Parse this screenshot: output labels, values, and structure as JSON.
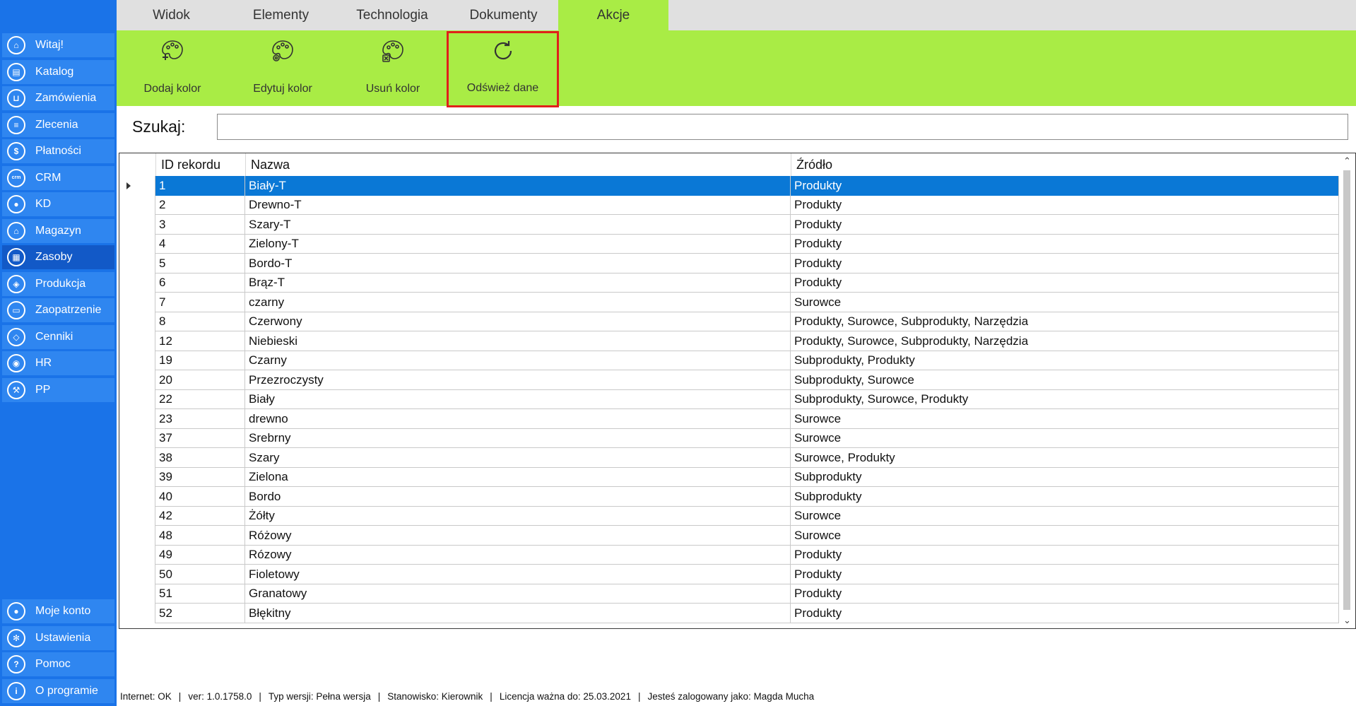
{
  "tabs": [
    {
      "label": "Widok",
      "active": false
    },
    {
      "label": "Elementy",
      "active": false
    },
    {
      "label": "Technologia",
      "active": false
    },
    {
      "label": "Dokumenty",
      "active": false
    },
    {
      "label": "Akcje",
      "active": true
    }
  ],
  "ribbon": {
    "buttons": [
      {
        "label": "Dodaj kolor",
        "icon": "palette-add-icon"
      },
      {
        "label": "Edytuj kolor",
        "icon": "palette-edit-icon"
      },
      {
        "label": "Usuń kolor",
        "icon": "palette-delete-icon"
      },
      {
        "label": "Odśwież dane",
        "icon": "refresh-icon",
        "highlighted": true
      }
    ]
  },
  "sidebar": {
    "items": [
      {
        "label": "Witaj!",
        "icon": "home-icon"
      },
      {
        "label": "Katalog",
        "icon": "book-icon"
      },
      {
        "label": "Zamówienia",
        "icon": "cart-icon"
      },
      {
        "label": "Zlecenia",
        "icon": "list-icon"
      },
      {
        "label": "Płatności",
        "icon": "dollar-icon"
      },
      {
        "label": "CRM",
        "icon": "crm-icon"
      },
      {
        "label": "KD",
        "icon": "person-icon"
      },
      {
        "label": "Magazyn",
        "icon": "warehouse-icon"
      },
      {
        "label": "Zasoby",
        "icon": "resources-icon",
        "active": true
      },
      {
        "label": "Produkcja",
        "icon": "production-icon"
      },
      {
        "label": "Zaopatrzenie",
        "icon": "truck-icon"
      },
      {
        "label": "Cenniki",
        "icon": "tag-icon"
      },
      {
        "label": "HR",
        "icon": "hr-icon"
      },
      {
        "label": "PP",
        "icon": "pp-icon"
      }
    ],
    "bottom_items": [
      {
        "label": "Moje konto",
        "icon": "account-icon"
      },
      {
        "label": "Ustawienia",
        "icon": "settings-icon"
      },
      {
        "label": "Pomoc",
        "icon": "help-icon"
      },
      {
        "label": "O programie",
        "icon": "info-icon"
      }
    ]
  },
  "search": {
    "label": "Szukaj:",
    "value": ""
  },
  "table": {
    "columns": [
      "ID rekordu",
      "Nazwa",
      "Źródło"
    ],
    "rows": [
      [
        "1",
        "Biały-T",
        "Produkty"
      ],
      [
        "2",
        "Drewno-T",
        "Produkty"
      ],
      [
        "3",
        "Szary-T",
        "Produkty"
      ],
      [
        "4",
        "Zielony-T",
        "Produkty"
      ],
      [
        "5",
        "Bordo-T",
        "Produkty"
      ],
      [
        "6",
        "Brąz-T",
        "Produkty"
      ],
      [
        "7",
        "czarny",
        "Surowce"
      ],
      [
        "8",
        "Czerwony",
        "Produkty, Surowce, Subprodukty, Narzędzia"
      ],
      [
        "12",
        "Niebieski",
        "Produkty, Surowce, Subprodukty, Narzędzia"
      ],
      [
        "19",
        "Czarny",
        "Subprodukty, Produkty"
      ],
      [
        "20",
        "Przezroczysty",
        "Subprodukty, Surowce"
      ],
      [
        "22",
        "Biały",
        "Subprodukty, Surowce, Produkty"
      ],
      [
        "23",
        "drewno",
        "Surowce"
      ],
      [
        "37",
        "Srebrny",
        "Surowce"
      ],
      [
        "38",
        "Szary",
        "Surowce, Produkty"
      ],
      [
        "39",
        "Zielona",
        "Subprodukty"
      ],
      [
        "40",
        "Bordo",
        "Subprodukty"
      ],
      [
        "42",
        "Żółty",
        "Surowce"
      ],
      [
        "48",
        "Różowy",
        "Surowce"
      ],
      [
        "49",
        "Rózowy",
        "Produkty"
      ],
      [
        "50",
        "Fioletowy",
        "Produkty"
      ],
      [
        "51",
        "Granatowy",
        "Produkty"
      ],
      [
        "52",
        "Błękitny",
        "Produkty"
      ]
    ],
    "selected_row": 0
  },
  "status_bar": {
    "items": [
      "Internet: OK",
      "ver: 1.0.1758.0",
      "Typ wersji: Pełna wersja",
      "Stanowisko: Kierownik",
      "Licencja ważna do: 25.03.2021",
      "Jesteś zalogowany jako: Magda Mucha"
    ]
  },
  "colors": {
    "sidebar": "#1a73e8",
    "ribbon": "#a9ec45",
    "selection": "#0a78d6",
    "highlight_border": "#e0201b"
  }
}
